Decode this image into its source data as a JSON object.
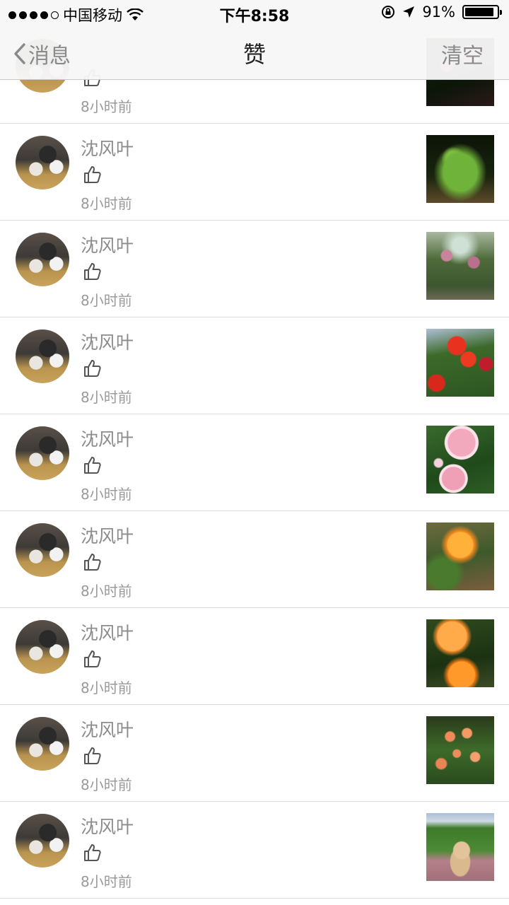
{
  "status_bar": {
    "carrier": "中国移动",
    "time": "下午8:58",
    "battery_percent": "91%",
    "battery_level": 0.91,
    "icons": [
      "signal-dots",
      "wifi-icon",
      "rotation-lock-icon",
      "location-arrow-icon",
      "battery-icon"
    ]
  },
  "nav": {
    "back_label": "消息",
    "title": "赞",
    "clear_label": "清空"
  },
  "likes": [
    {
      "name": "",
      "time": "8小时前",
      "thumb": "dark-red-flowers"
    },
    {
      "name": "沈风叶",
      "time": "8小时前",
      "thumb": "green-shrub"
    },
    {
      "name": "沈风叶",
      "time": "8小时前",
      "thumb": "pink-bush-garden"
    },
    {
      "name": "沈风叶",
      "time": "8小时前",
      "thumb": "red-roses"
    },
    {
      "name": "沈风叶",
      "time": "8小时前",
      "thumb": "pink-roses"
    },
    {
      "name": "沈风叶",
      "time": "8小时前",
      "thumb": "orange-rose"
    },
    {
      "name": "沈风叶",
      "time": "8小时前",
      "thumb": "orange-roses"
    },
    {
      "name": "沈风叶",
      "time": "8小时前",
      "thumb": "orange-rose-bush"
    },
    {
      "name": "沈风叶",
      "time": "8小时前",
      "thumb": "puppy-on-grass"
    }
  ]
}
